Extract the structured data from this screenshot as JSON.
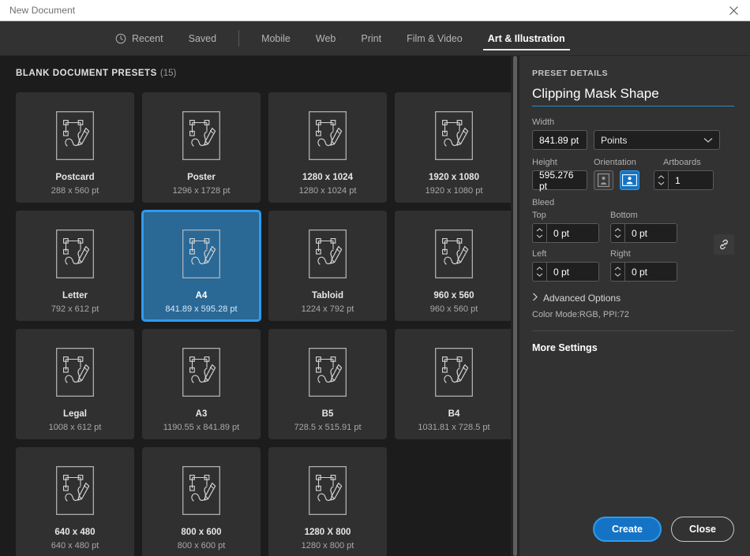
{
  "window": {
    "title": "New Document",
    "close_icon": "close-icon"
  },
  "tabs": {
    "recent": "Recent",
    "saved": "Saved",
    "mobile": "Mobile",
    "web": "Web",
    "print": "Print",
    "film_video": "Film & Video",
    "art_illustration": "Art & Illustration",
    "recent_icon": "clock-icon"
  },
  "presets": {
    "heading": "BLANK DOCUMENT PRESETS",
    "count": "(15)",
    "items": [
      {
        "name": "Postcard",
        "size": "288 x 560 pt",
        "selected": false
      },
      {
        "name": "Poster",
        "size": "1296 x 1728 pt",
        "selected": false
      },
      {
        "name": "1280 x 1024",
        "size": "1280 x 1024 pt",
        "selected": false
      },
      {
        "name": "1920 x 1080",
        "size": "1920 x 1080 pt",
        "selected": false
      },
      {
        "name": "Letter",
        "size": "792 x 612 pt",
        "selected": false
      },
      {
        "name": "A4",
        "size": "841.89 x 595.28 pt",
        "selected": true
      },
      {
        "name": "Tabloid",
        "size": "1224 x 792 pt",
        "selected": false
      },
      {
        "name": "960 x 560",
        "size": "960 x 560 pt",
        "selected": false
      },
      {
        "name": "Legal",
        "size": "1008 x 612 pt",
        "selected": false
      },
      {
        "name": "A3",
        "size": "1190.55 x 841.89 pt",
        "selected": false
      },
      {
        "name": "B5",
        "size": "728.5 x 515.91 pt",
        "selected": false
      },
      {
        "name": "B4",
        "size": "1031.81 x 728.5 pt",
        "selected": false
      },
      {
        "name": "640 x 480",
        "size": "640 x 480 pt",
        "selected": false
      },
      {
        "name": "800 x 600",
        "size": "800 x 600 pt",
        "selected": false
      },
      {
        "name": "1280 X 800",
        "size": "1280 x 800 pt",
        "selected": false
      }
    ],
    "thumb_icon": "artboard-pen-icon"
  },
  "details": {
    "header": "PRESET DETAILS",
    "document_name": "Clipping Mask Shape",
    "width_label": "Width",
    "width_value": "841.89 pt",
    "units_value": "Points",
    "units_chevron_icon": "chevron-down-icon",
    "height_label": "Height",
    "height_value": "595.276 pt",
    "orientation_label": "Orientation",
    "orientation_portrait_icon": "orientation-portrait-icon",
    "orientation_landscape_icon": "orientation-landscape-icon",
    "artboards_label": "Artboards",
    "artboards_value": "1",
    "bleed_label": "Bleed",
    "bleed_top_label": "Top",
    "bleed_top_value": "0 pt",
    "bleed_bottom_label": "Bottom",
    "bleed_bottom_value": "0 pt",
    "bleed_left_label": "Left",
    "bleed_left_value": "0 pt",
    "bleed_right_label": "Right",
    "bleed_right_value": "0 pt",
    "bleed_link_icon": "link-chain-icon",
    "advanced_options": "Advanced Options",
    "advanced_chevron_icon": "chevron-right-icon",
    "color_mode": "Color Mode:RGB, PPI:72",
    "more_settings": "More Settings"
  },
  "footer": {
    "create_label": "Create",
    "close_label": "Close"
  },
  "colors": {
    "accent": "#2d9bf0",
    "accent_fill": "#1473c4",
    "selected_card": "#2a6896",
    "panel_bg": "#323232",
    "grid_bg": "#1c1c1c",
    "card_bg": "#303030"
  }
}
